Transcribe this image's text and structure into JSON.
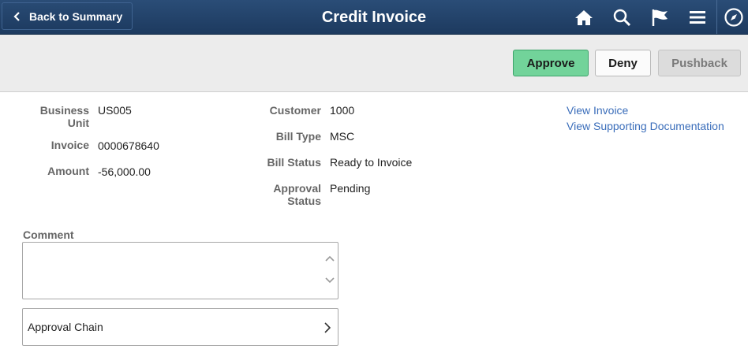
{
  "header": {
    "back_label": "Back to Summary",
    "title": "Credit Invoice",
    "icons": [
      "home-icon",
      "search-icon",
      "flag-icon",
      "menu-icon",
      "navbar-compass-icon"
    ]
  },
  "toolbar": {
    "approve_label": "Approve",
    "deny_label": "Deny",
    "pushback_label": "Pushback"
  },
  "fields": {
    "business_unit_label_1": "Business",
    "business_unit_label_2": "Unit",
    "business_unit_value": "US005",
    "invoice_label": "Invoice",
    "invoice_value": "0000678640",
    "amount_label": "Amount",
    "amount_value": "-56,000.00",
    "customer_label": "Customer",
    "customer_value": "1000",
    "bill_type_label": "Bill Type",
    "bill_type_value": "MSC",
    "bill_status_label": "Bill Status",
    "bill_status_value": "Ready to Invoice",
    "approval_status_label_1": "Approval",
    "approval_status_label_2": "Status",
    "approval_status_value": "Pending"
  },
  "links": {
    "view_invoice": "View Invoice",
    "view_supporting": "View Supporting Documentation"
  },
  "comment": {
    "label": "Comment",
    "value": ""
  },
  "approval_chain": {
    "label": "Approval Chain"
  },
  "colors": {
    "header": "#1d3a5f",
    "approve": "#72d39a",
    "link": "#3a6dba"
  }
}
